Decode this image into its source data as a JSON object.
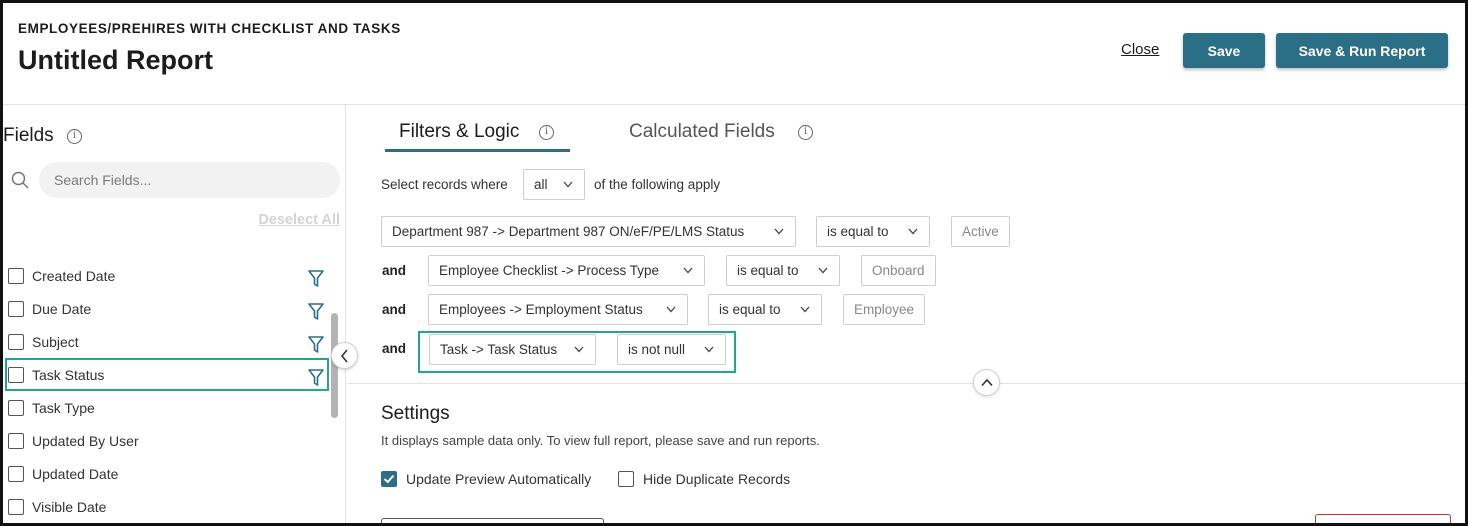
{
  "header": {
    "eyebrow": "EMPLOYEES/PREHIRES WITH CHECKLIST AND TASKS",
    "title": "Untitled Report",
    "close_label": "Close",
    "save_label": "Save",
    "save_run_label": "Save & Run Report",
    "accent_color": "#2a6f86"
  },
  "fields_panel": {
    "title": "Fields",
    "search_placeholder": "Search Fields...",
    "deselect_all": "Deselect All",
    "items": [
      {
        "label": "Created Date",
        "checked": false,
        "filter_icon": true
      },
      {
        "label": "Due Date",
        "checked": false,
        "filter_icon": true
      },
      {
        "label": "Subject",
        "checked": false,
        "filter_icon": true
      },
      {
        "label": "Task Status",
        "checked": false,
        "filter_icon": true,
        "highlighted": true
      },
      {
        "label": "Task Type",
        "checked": false,
        "filter_icon": false
      },
      {
        "label": "Updated By User",
        "checked": false,
        "filter_icon": false
      },
      {
        "label": "Updated Date",
        "checked": false,
        "filter_icon": false
      },
      {
        "label": "Visible Date",
        "checked": false,
        "filter_icon": false
      }
    ]
  },
  "tabs": [
    {
      "label": "Filters & Logic",
      "active": true
    },
    {
      "label": "Calculated Fields",
      "active": false
    }
  ],
  "filters": {
    "select_prefix": "Select records where",
    "match_value": "all",
    "select_suffix": "of the following apply",
    "rows": [
      {
        "connector": "",
        "field": "Department 987 -> Department 987 ON/eF/PE/LMS Status",
        "operator": "is equal to",
        "value": "Active"
      },
      {
        "connector": "and",
        "field": "Employee Checklist -> Process Type",
        "operator": "is equal to",
        "value": "Onboard"
      },
      {
        "connector": "and",
        "field": "Employees -> Employment Status",
        "operator": "is equal to",
        "value": "Employee"
      },
      {
        "connector": "and",
        "field": "Task -> Task Status",
        "operator": "is not null",
        "value": ""
      }
    ],
    "highlight_color": "#1fa98c"
  },
  "settings": {
    "title": "Settings",
    "description": "It displays sample data only. To view full report, please save and run reports.",
    "update_preview_label": "Update Preview Automatically",
    "update_preview_checked": true,
    "hide_duplicates_label": "Hide Duplicate Records",
    "hide_duplicates_checked": false
  }
}
